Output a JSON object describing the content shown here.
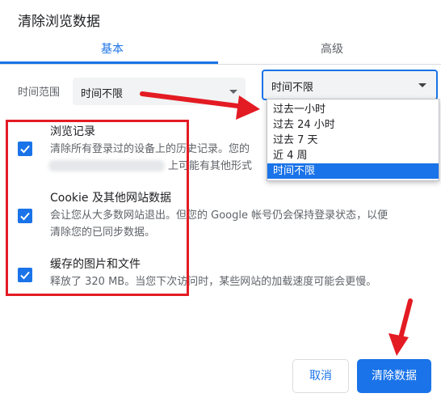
{
  "dialog": {
    "title": "清除浏览数据"
  },
  "tabs": [
    {
      "label": "基本",
      "active": true
    },
    {
      "label": "高级",
      "active": false
    }
  ],
  "time_range": {
    "label": "时间范围",
    "value": "时间不限"
  },
  "options": [
    {
      "title": "浏览记录",
      "desc_lines": [
        "清除所有登录过的设备上的历史记录。您的",
        "上可能有其他形式"
      ],
      "checked": true
    },
    {
      "title": "Cookie 及其他网站数据",
      "desc_lines": [
        "会让您从大多数网站退出。但您的 Google 帐号仍会保持登录状态，以便",
        "清除您的已同步数据。"
      ],
      "checked": true
    },
    {
      "title": "缓存的图片和文件",
      "desc_lines": [
        "释放了 320 MB。当您下次访问时，某些网站的加载速度可能会更慢。"
      ],
      "checked": true
    }
  ],
  "dropdown": {
    "selected": "时间不限",
    "items": [
      "过去一小时",
      "过去 24 小时",
      "过去 7 天",
      "近 4 周",
      "时间不限"
    ],
    "selected_index": 4
  },
  "buttons": {
    "cancel": "取消",
    "clear": "清除数据"
  },
  "colors": {
    "accent": "#1a73e8",
    "annotation": "#e31b23"
  }
}
